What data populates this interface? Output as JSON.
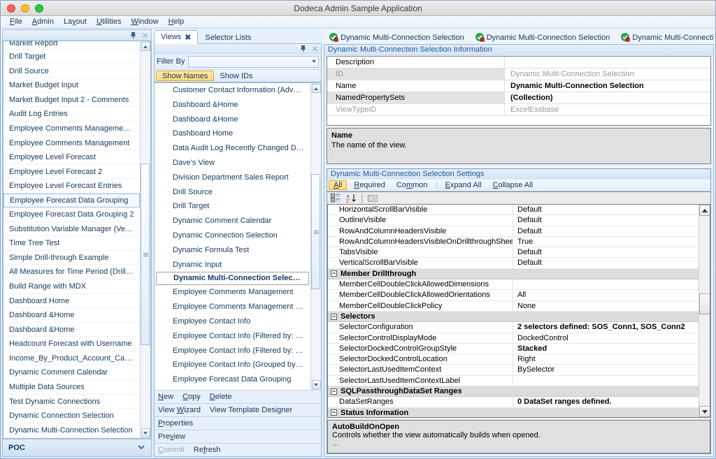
{
  "window": {
    "title": "Dodeca Admin Sample Application",
    "traffic": [
      "close",
      "minimize",
      "maximize"
    ]
  },
  "menubar": {
    "items": [
      {
        "label": "File",
        "mnemonic": "F"
      },
      {
        "label": "Admin",
        "mnemonic": "A"
      },
      {
        "label": "Layout",
        "mnemonic": "y"
      },
      {
        "label": "Utilities",
        "mnemonic": "U"
      },
      {
        "label": "Window",
        "mnemonic": "W"
      },
      {
        "label": "Help",
        "mnemonic": "H"
      }
    ]
  },
  "left_panel": {
    "pin_icon": "pin-icon",
    "close_icon": "close-icon",
    "items": [
      "Market Report",
      "Drill Target",
      "Drill Source",
      "Market Budget Input",
      "Market Budget Input 2 - Comments",
      "Audit Log Entries",
      "Employee  Comments  Management  (Es…",
      "Employee Comments Management",
      "Employee Level Forecast",
      "Employee Level Forecast 2",
      "Employee Level Forecast Entries",
      "Employee Forecast Data Grouping",
      "Employee Forecast Data Grouping 2",
      "Substitution Variable Manager (Vess)",
      "Time Tree Test",
      "Simple Drill-through Example",
      "All  Measures  for  Time  Period  (Drill  Tar…",
      "Build Range with MDX",
      "Dashboard Home",
      "Dashboard &Home",
      "Dashboard &Home",
      "Headcount Forecast with Username",
      "Income_By_Product_Account_Cascade",
      "Dynamic Comment Calendar",
      "Multiple Data Sources",
      "Test Dynamic Connections",
      "Dynamic Connection Selection",
      "Dynamic Multi-Connection Selection"
    ],
    "selected_index": 11,
    "group_footer": {
      "label": "POC",
      "chevron_icon": "chevron-down-icon"
    }
  },
  "mid_panel": {
    "tabs": [
      {
        "label": "Views",
        "active": true,
        "close_icon": "close-icon"
      },
      {
        "label": "Selector Lists",
        "active": false
      }
    ],
    "pin_icon": "pin-icon",
    "close_icon": "close-icon",
    "filter": {
      "label": "Filter By",
      "value": "",
      "placeholder": "",
      "dropdown_icon": "chevron-down-icon"
    },
    "segments": [
      {
        "label": "Show Names",
        "active": true
      },
      {
        "label": "Show IDs",
        "active": false
      }
    ],
    "items": [
      "Customer  Contact  Information  (Advent…",
      "Dashboard &Home",
      "Dashboard &Home",
      "Dashboard Home",
      "Data Audit Log Recently Changed Data",
      "Dave's View",
      "Division Department Sales Report",
      "Drill Source",
      "Drill Target",
      "Dynamic Comment Calendar",
      "Dynamic Connection Selection",
      "Dynamic Formula Test",
      "Dynamic Input",
      "Dynamic Multi-Connection Selection",
      "Employee Comments Management",
      "Employee  Comments  Management  (Es…",
      "Employee Contact Info",
      "Employee Contact Info (Filtered by: La…",
      "Employee Contact Info (Filtered by: La…",
      "Employee Contact Info (Grouped by: J…",
      "Employee Forecast Data Grouping"
    ],
    "selected_index": 13,
    "actions": [
      [
        {
          "label": "New",
          "mnemonic": "N",
          "enabled": true
        },
        {
          "label": "Copy",
          "mnemonic": "C",
          "enabled": true
        },
        {
          "label": "Delete",
          "mnemonic": "D",
          "enabled": true
        }
      ],
      [
        {
          "label": "View Wizard",
          "mnemonic": "W",
          "enabled": true
        },
        {
          "label": "View Template Designer",
          "mnemonic": "g",
          "enabled": true
        }
      ],
      [
        {
          "label": "Properties",
          "mnemonic": "P",
          "enabled": true
        }
      ],
      [
        {
          "label": "Preview",
          "mnemonic": "v",
          "enabled": true
        }
      ],
      [
        {
          "label": "Commit",
          "mnemonic": "C",
          "enabled": false
        },
        {
          "label": "Refresh",
          "mnemonic": "f",
          "enabled": true
        }
      ]
    ]
  },
  "right_panel": {
    "tabs": [
      {
        "label": "Dynamic Multi-Connection Selection",
        "icon": "view-check-icon",
        "active": false
      },
      {
        "label": "Dynamic Multi-Connection Selection",
        "icon": "view-check-icon",
        "active": false
      },
      {
        "label": "Dynamic Multi-Connection Selection",
        "icon": "view-check-icon",
        "active": true
      }
    ],
    "tab_nav": {
      "menu_icon": "tab-list-icon",
      "prev_icon": "chevron-left-icon",
      "next_icon": "chevron-right-icon"
    },
    "info_section": {
      "title": "Dynamic Multi-Connection Selection Information",
      "rows": [
        {
          "key": "Description",
          "value": "",
          "key_style": "normal",
          "value_style": "normal"
        },
        {
          "key": "ID",
          "value": "Dynamic Multi-Connection Selection",
          "key_style": "dim",
          "value_style": "dim"
        },
        {
          "key": "Name",
          "value": "Dynamic Multi-Connection Selection",
          "key_style": "normal",
          "value_style": "bold"
        },
        {
          "key": "NamedPropertySets",
          "value": "(Collection)",
          "key_style": "normal",
          "value_style": "bold"
        },
        {
          "key": "ViewTypeID",
          "value": "ExcelEssbase",
          "key_style": "dim",
          "value_style": "dim"
        }
      ],
      "description": {
        "title": "Name",
        "text": "The name of the view."
      }
    },
    "settings_section": {
      "title": "Dynamic Multi-Connection Selection Settings",
      "toolbar": [
        {
          "label": "All",
          "mnemonic": "A",
          "active": true
        },
        {
          "label": "Required",
          "mnemonic": "R",
          "active": false
        },
        {
          "label": "Common",
          "mnemonic": "m",
          "active": false
        },
        {
          "label": "Expand All",
          "mnemonic": "E",
          "active": false
        },
        {
          "label": "Collapse All",
          "mnemonic": "C",
          "active": false
        }
      ],
      "grid_toolbar": [
        {
          "icon": "categorized-icon",
          "name": "categorized-button"
        },
        {
          "icon": "alphabetical-sort-icon",
          "name": "alphabetical-button"
        },
        {
          "icon": "property-pages-icon",
          "name": "property-pages-button"
        }
      ],
      "rows": [
        {
          "type": "prop",
          "key": "HorizontalScrollBarVisible",
          "value": "Default",
          "bold": false
        },
        {
          "type": "prop",
          "key": "OutlineVisible",
          "value": "Default",
          "bold": false
        },
        {
          "type": "prop",
          "key": "RowAndColumnHeadersVisible",
          "value": "Default",
          "bold": false
        },
        {
          "type": "prop",
          "key": "RowAndColumnHeadersVisibleOnDrillthroughSheet",
          "value": "True",
          "bold": false
        },
        {
          "type": "prop",
          "key": "TabsVisible",
          "value": "Default",
          "bold": false
        },
        {
          "type": "prop",
          "key": "VerticalScrollBarVisible",
          "value": "Default",
          "bold": false
        },
        {
          "type": "category",
          "key": "Member Drillthrough",
          "value": "",
          "expander": "−"
        },
        {
          "type": "prop",
          "key": "MemberCellDoubleClickAllowedDimensions",
          "value": "",
          "bold": false
        },
        {
          "type": "prop",
          "key": "MemberCellDoubleClickAllowedOrientations",
          "value": "All",
          "bold": false
        },
        {
          "type": "prop",
          "key": "MemberCellDoubleClickPolicy",
          "value": "None",
          "bold": false
        },
        {
          "type": "category",
          "key": "Selectors",
          "value": "",
          "expander": "−"
        },
        {
          "type": "prop",
          "key": "SelectorConfiguration",
          "value": "2 selectors defined: SOS_Conn1, SOS_Conn2",
          "bold": true
        },
        {
          "type": "prop",
          "key": "SelectorControlDisplayMode",
          "value": "DockedControl",
          "bold": false
        },
        {
          "type": "prop",
          "key": "SelectorDockedControlGroupStyle",
          "value": "Stacked",
          "bold": true
        },
        {
          "type": "prop",
          "key": "SelectorDockedControlLocation",
          "value": "Right",
          "bold": false
        },
        {
          "type": "prop",
          "key": "SelectorLastUsedItemContext",
          "value": "BySelector",
          "bold": false
        },
        {
          "type": "prop",
          "key": "SelectorLastUsedItemContextLabel",
          "value": "",
          "bold": false
        },
        {
          "type": "category",
          "key": "SQLPassthroughDataSet Ranges",
          "value": "",
          "expander": "−"
        },
        {
          "type": "prop",
          "key": "DataSetRanges",
          "value": "0 DataSet ranges defined.",
          "bold": true
        },
        {
          "type": "category",
          "key": "Status Information",
          "value": "",
          "expander": "−"
        }
      ],
      "help": {
        "title": "AutoBuildOnOpen",
        "text": "Controls whether the view automatically builds when opened.",
        "more": "..."
      }
    }
  },
  "colors": {
    "accent": "#ffd978",
    "chrome": "#dce9f7",
    "text": "#16365c",
    "link": "#1e5a96"
  }
}
